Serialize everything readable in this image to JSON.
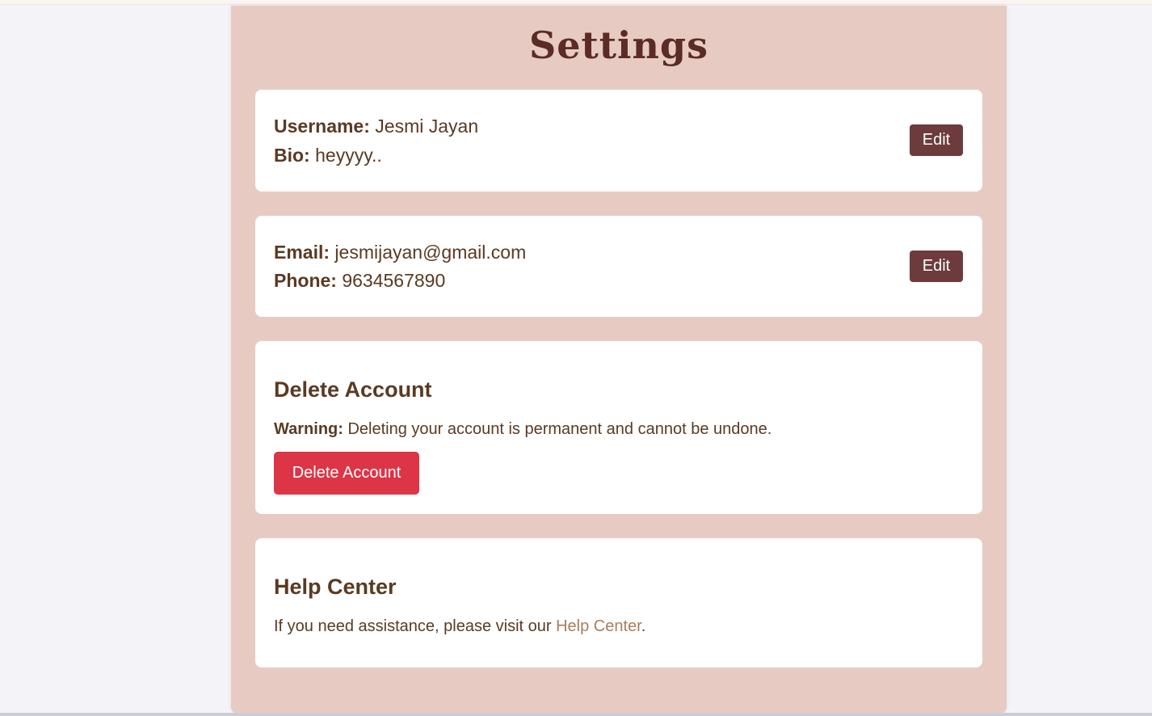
{
  "page": {
    "title": "Settings"
  },
  "profile": {
    "username_label": "Username:",
    "username_value": "Jesmi Jayan",
    "bio_label": "Bio:",
    "bio_value": "heyyyy..",
    "edit_label": "Edit"
  },
  "contact": {
    "email_label": "Email:",
    "email_value": "jesmijayan@gmail.com",
    "phone_label": "Phone:",
    "phone_value": "9634567890",
    "edit_label": "Edit"
  },
  "delete_account": {
    "heading": "Delete Account",
    "warning_label": "Warning:",
    "warning_text": "Deleting your account is permanent and cannot be undone.",
    "button_label": "Delete Account"
  },
  "help_center": {
    "heading": "Help Center",
    "text_before": "If you need assistance, please visit our",
    "link_label": "Help Center",
    "text_after": "."
  },
  "colors": {
    "panel_bg": "#e7cbc3",
    "title": "#5b2b26",
    "text": "#5a3a22",
    "edit_button": "#6d3b3c",
    "delete_button": "#dc3545",
    "link": "#a87e5c"
  }
}
